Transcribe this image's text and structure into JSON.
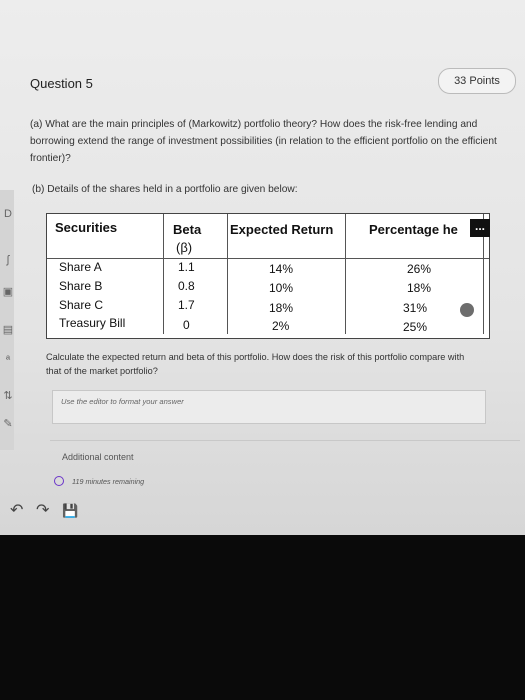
{
  "question": {
    "title": "Question 5",
    "points": "33 Points",
    "part_a": "(a) What are the main principles of (Markowitz) portfolio theory? How does the risk-free lending and borrowing extend the range of investment possibilities (in relation to the efficient portfolio on the efficient frontier)?",
    "part_b": "(b) Details of the shares held in a portfolio are given below:"
  },
  "table": {
    "headers": {
      "securities": "Securities",
      "beta": "Beta",
      "beta_symbol": "(β)",
      "expected_return": "Expected Return",
      "percentage": "Percentage he"
    },
    "rows": [
      {
        "name": "Share A",
        "beta": "1.1",
        "return": "14%",
        "pct": "26%"
      },
      {
        "name": "Share B",
        "beta": "0.8",
        "return": "10%",
        "pct": "18%"
      },
      {
        "name": "Share C",
        "beta": "1.7",
        "return": "18%",
        "pct": "31%"
      },
      {
        "name": "Treasury Bill",
        "beta": "0",
        "return": "2%",
        "pct": "25%"
      }
    ],
    "more_label": "..."
  },
  "followup": "Calculate the expected return and beta of this portfolio. How does the risk of this portfolio compare with that of the market portfolio?",
  "editor": {
    "placeholder": "Use the editor to format your answer"
  },
  "additional_content": "Additional content",
  "timer": "119 minutes remaining",
  "toolbar": {
    "undo": "↶",
    "redo": "↷",
    "save": "💾"
  },
  "colors": {
    "timer_icon": "#6b35c9",
    "table_bg": "#ffffff",
    "screen_bg": "#e8e8e8"
  }
}
